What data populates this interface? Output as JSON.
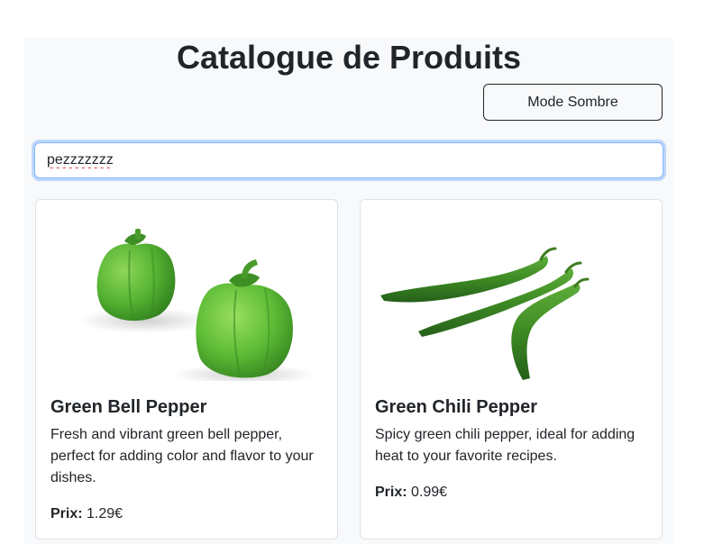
{
  "header": {
    "title": "Catalogue de Produits",
    "mode_button_label": "Mode Sombre"
  },
  "search": {
    "value": "pezzzzzzz",
    "placeholder": ""
  },
  "price_label": "Prix:",
  "products": [
    {
      "name": "Green Bell Pepper",
      "description": "Fresh and vibrant green bell pepper, perfect for adding color and flavor to your dishes.",
      "price": "1.29€",
      "image": "green-bell-pepper-photo"
    },
    {
      "name": "Green Chili Pepper",
      "description": "Spicy green chili pepper, ideal for adding heat to your favorite recipes.",
      "price": "0.99€",
      "image": "green-chili-pepper-photo"
    }
  ],
  "colors": {
    "background": "#f8f9fa",
    "text": "#212529",
    "card_border": "#dee2e6",
    "focus_ring": "#86b7fe",
    "pepper_green": "#4caf2f"
  }
}
